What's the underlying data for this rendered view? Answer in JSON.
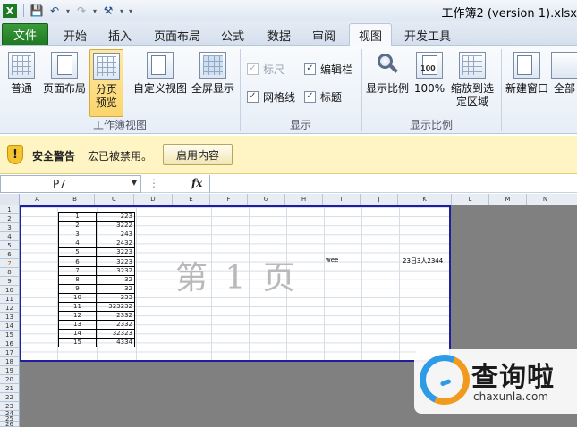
{
  "window": {
    "title": "工作簿2 (version 1).xlsx"
  },
  "tabs": [
    {
      "label": "文件"
    },
    {
      "label": "开始"
    },
    {
      "label": "插入"
    },
    {
      "label": "页面布局"
    },
    {
      "label": "公式"
    },
    {
      "label": "数据"
    },
    {
      "label": "审阅"
    },
    {
      "label": "视图"
    },
    {
      "label": "开发工具"
    }
  ],
  "active_tab": "视图",
  "ribbon": {
    "workbook_views": {
      "group_label": "工作簿视图",
      "buttons": [
        {
          "label": "普通"
        },
        {
          "label": "页面布局"
        },
        {
          "label": "分页预览"
        },
        {
          "label": "自定义视图"
        },
        {
          "label": "全屏显示"
        }
      ],
      "active_view": "分页预览"
    },
    "show": {
      "group_label": "显示",
      "checkboxes": [
        {
          "label": "标尺",
          "checked": true,
          "enabled": false
        },
        {
          "label": "编辑栏",
          "checked": true,
          "enabled": true
        },
        {
          "label": "网格线",
          "checked": true,
          "enabled": true
        },
        {
          "label": "标题",
          "checked": true,
          "enabled": true
        }
      ]
    },
    "zoom": {
      "group_label": "显示比例",
      "buttons": [
        {
          "label": "显示比例"
        },
        {
          "label": "100%"
        },
        {
          "label": "缩放到选定区域"
        }
      ]
    },
    "window": {
      "buttons": [
        {
          "label": "新建窗口"
        },
        {
          "label": "全部"
        }
      ]
    }
  },
  "security_bar": {
    "title": "安全警告",
    "message": "宏已被禁用。",
    "button_label": "启用内容"
  },
  "formula_bar": {
    "name_box": "P7",
    "fx_label": "fx",
    "formula": ""
  },
  "sheet": {
    "columns": [
      "A",
      "B",
      "C",
      "D",
      "E",
      "F",
      "G",
      "H",
      "I",
      "J",
      "K",
      "L",
      "M",
      "N"
    ],
    "rows": [
      "1",
      "2",
      "3",
      "4",
      "5",
      "6",
      "7",
      "8",
      "9",
      "10",
      "11",
      "12",
      "13",
      "14",
      "15",
      "16",
      "17",
      "18",
      "19",
      "20",
      "21",
      "22",
      "23",
      "24",
      "25",
      "26"
    ],
    "table": [
      {
        "b": "1",
        "c": "223"
      },
      {
        "b": "2",
        "c": "3222"
      },
      {
        "b": "3",
        "c": "243"
      },
      {
        "b": "4",
        "c": "2432"
      },
      {
        "b": "5",
        "c": "3223"
      },
      {
        "b": "6",
        "c": "3223"
      },
      {
        "b": "7",
        "c": "3232"
      },
      {
        "b": "8",
        "c": "32"
      },
      {
        "b": "9",
        "c": "32"
      },
      {
        "b": "10",
        "c": "233"
      },
      {
        "b": "11",
        "c": "323232"
      },
      {
        "b": "12",
        "c": "2332"
      },
      {
        "b": "13",
        "c": "2332"
      },
      {
        "b": "14",
        "c": "32323"
      },
      {
        "b": "15",
        "c": "4334"
      }
    ],
    "cell_i6": "wee",
    "cell_k6": "23日3人2344",
    "page_watermark": "第 1 页"
  },
  "watermark_logo": {
    "text_cn": "查询啦",
    "text_en": "chaxunla.com"
  }
}
